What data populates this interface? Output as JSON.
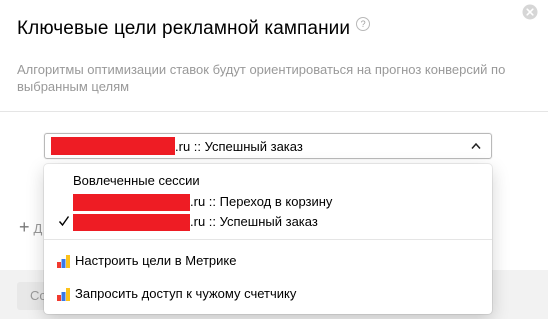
{
  "dialog": {
    "title": "Ключевые цели рекламной кампании",
    "help_glyph": "?",
    "description": "Алгоритмы оптимизации ставок будут ориентироваться на прогноз конверсий по выбранным целям",
    "close_icon": "close-icon"
  },
  "goal_select": {
    "selected_suffix": ".ru :: Успешный заказ",
    "selected_redacted": true,
    "chevron": "chevron-up-icon"
  },
  "add_goal": {
    "plus": "+",
    "label_visible": "Д"
  },
  "footer": {
    "button_label_visible": "Со"
  },
  "dropdown": {
    "group_header": "Вовлеченные сессии",
    "options": [
      {
        "suffix": ".ru :: Переход в корзину",
        "selected": false,
        "redacted": true
      },
      {
        "suffix": ".ru :: Успешный заказ",
        "selected": true,
        "redacted": true
      }
    ],
    "actions": [
      {
        "label": "Настроить цели в Метрике",
        "icon": "metrika-icon"
      },
      {
        "label": "Запросить доступ к чужому счетчику",
        "icon": "metrika-icon"
      }
    ]
  },
  "colors": {
    "redaction": "#ee1c24",
    "metrika_red": "#f23a2f",
    "metrika_blue": "#3a78e8",
    "metrika_yellow": "#fcc21b"
  }
}
